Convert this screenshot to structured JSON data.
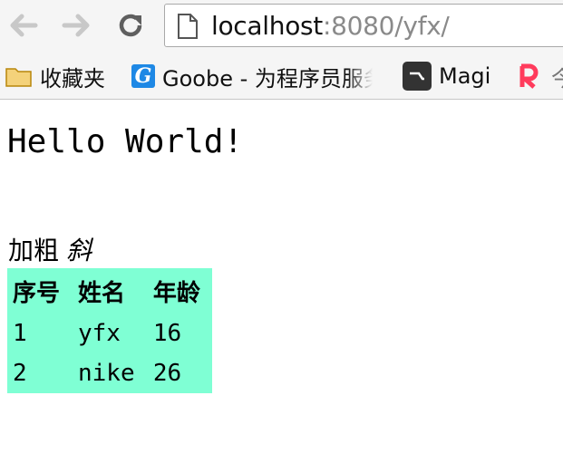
{
  "browser": {
    "url_host": "localhost",
    "url_rest": ":8080/yfx/",
    "bookmarks": [
      {
        "label": "收藏夹",
        "icon": "folder-icon"
      },
      {
        "label": "Goobe - 为程序员服务",
        "icon": "goobe-icon"
      },
      {
        "label": "Magi",
        "icon": "magi-icon"
      },
      {
        "label": "今",
        "icon": "r-icon"
      }
    ]
  },
  "page": {
    "heading": "Hello World!",
    "bold_text": "加粗",
    "italic_text": "斜",
    "table": {
      "background": "#7fffd4",
      "headers": [
        "序号",
        "姓名",
        "年龄"
      ],
      "rows": [
        [
          "1",
          "yfx",
          "16"
        ],
        [
          "2",
          "nike",
          "26"
        ]
      ]
    }
  }
}
